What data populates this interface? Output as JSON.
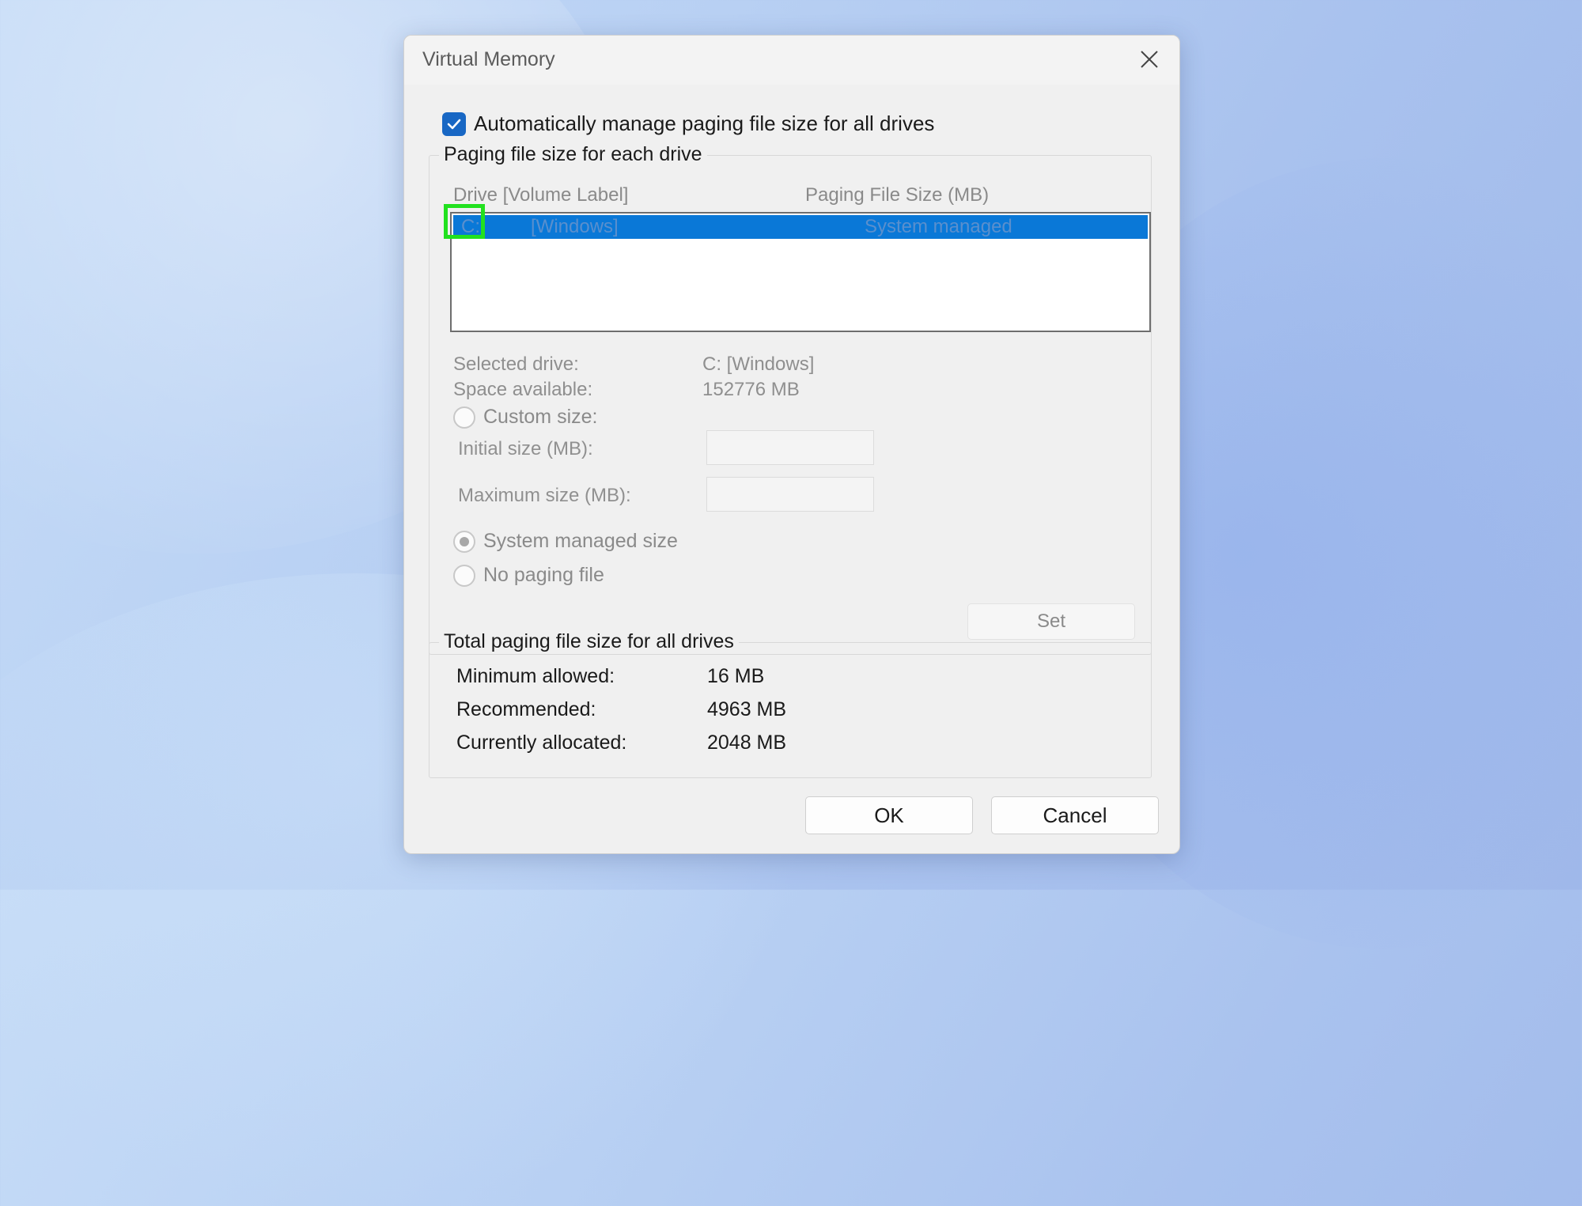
{
  "dialog": {
    "title": "Virtual Memory",
    "auto_manage_label": "Automatically manage paging file size for all drives",
    "auto_manage_checked": true
  },
  "paging_group": {
    "legend": "Paging file size for each drive",
    "columns": {
      "drive": "Drive  [Volume Label]",
      "size": "Paging File Size (MB)"
    },
    "drives": [
      {
        "letter": "C:",
        "label": "[Windows]",
        "size": "System managed",
        "selected": true
      }
    ],
    "selected_drive_label": "Selected drive:",
    "selected_drive_value": "C:  [Windows]",
    "space_available_label": "Space available:",
    "space_available_value": "152776 MB",
    "custom_size_label": "Custom size:",
    "initial_size_label": "Initial size (MB):",
    "initial_size_value": "",
    "maximum_size_label": "Maximum size (MB):",
    "maximum_size_value": "",
    "system_managed_label": "System managed size",
    "no_paging_label": "No paging file",
    "set_label": "Set",
    "selected_option": "system_managed"
  },
  "total_group": {
    "legend": "Total paging file size for all drives",
    "minimum_label": "Minimum allowed:",
    "minimum_value": "16 MB",
    "recommended_label": "Recommended:",
    "recommended_value": "4963 MB",
    "allocated_label": "Currently allocated:",
    "allocated_value": "2048 MB"
  },
  "buttons": {
    "ok": "OK",
    "cancel": "Cancel"
  },
  "colors": {
    "accent": "#0a78d7",
    "checkbox": "#1867c4",
    "highlight": "#22e11f"
  }
}
